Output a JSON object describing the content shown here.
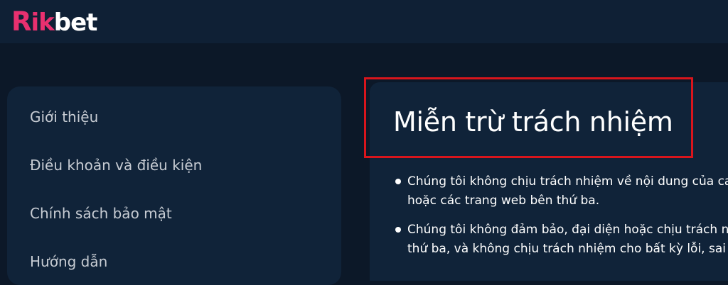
{
  "header": {
    "logo": {
      "part1": "R",
      "part2": "ik",
      "part3": "bet"
    }
  },
  "sidebar": {
    "items": [
      {
        "label": "Giới thiệu"
      },
      {
        "label": "Điều khoản và điều kiện"
      },
      {
        "label": "Chính sách bảo mật"
      },
      {
        "label": "Hướng dẫn"
      }
    ]
  },
  "content": {
    "title": "Miễn trừ trách nhiệm",
    "paragraphs": [
      {
        "line1": "Chúng tôi không chịu trách nhiệm về nội dung của ca",
        "line2": "hoặc các trang web bên thứ ba."
      },
      {
        "line1": "Chúng tôi không đảm bảo, đại diện hoặc chịu trách n",
        "line2": "thứ ba, và không chịu trách nhiệm cho bất kỳ lỗi, sai"
      }
    ]
  },
  "colors": {
    "background": "#0c1828",
    "header": "#0f2035",
    "panel": "#102339",
    "brand_pink": "#e8306f",
    "highlight_red": "#d9151c"
  }
}
